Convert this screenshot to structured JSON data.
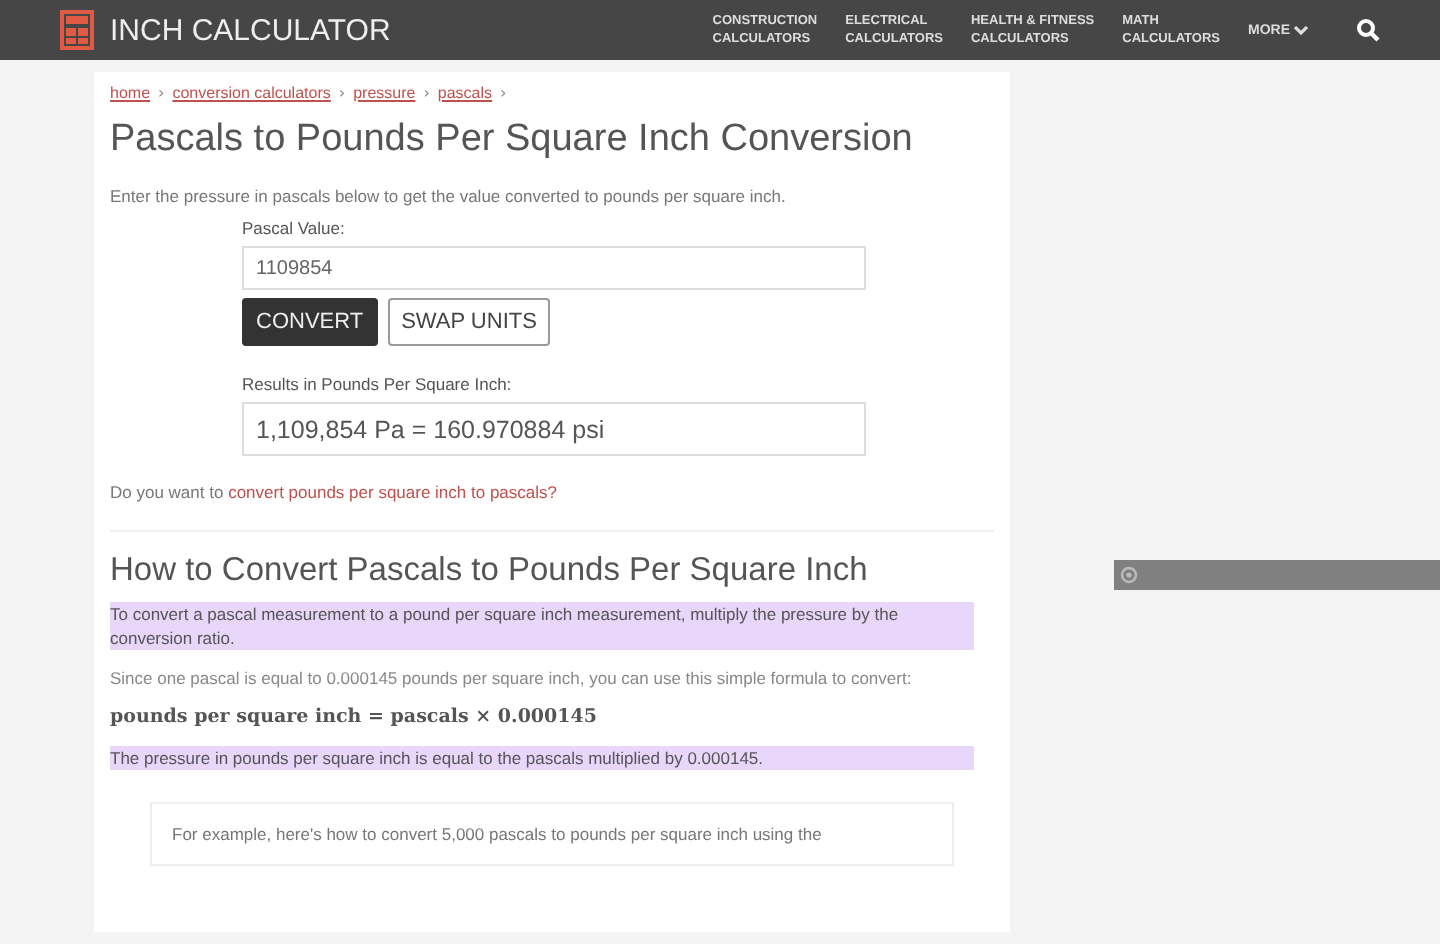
{
  "header": {
    "logo": "INCH CALCULATOR",
    "nav": [
      {
        "line1": "CONSTRUCTION",
        "line2": "CALCULATORS"
      },
      {
        "line1": "ELECTRICAL",
        "line2": "CALCULATORS"
      },
      {
        "line1": "HEALTH & FITNESS",
        "line2": "CALCULATORS"
      },
      {
        "line1": "MATH",
        "line2": "CALCULATORS"
      }
    ],
    "more": "MORE"
  },
  "breadcrumbs": [
    "home",
    "conversion calculators",
    "pressure",
    "pascals"
  ],
  "breadcrumb_separator": "›",
  "title": "Pascals to Pounds Per Square Inch Conversion",
  "intro": "Enter the pressure in pascals below to get the value converted to pounds per square inch.",
  "input": {
    "label": "Pascal Value:",
    "value": "1109854"
  },
  "buttons": [
    {
      "label": "CONVERT",
      "kind": "primary"
    },
    {
      "label": "SWAP UNITS",
      "kind": "secondary"
    }
  ],
  "result": {
    "label": "Results in Pounds Per Square Inch:",
    "value": "1,109,854 Pa = 160.970884 psi"
  },
  "reverse": {
    "prefix": "Do you want to ",
    "link": "convert pounds per square inch to pascals?"
  },
  "section_title": "How to Convert Pascals to Pounds Per Square Inch",
  "paragraphs": [
    {
      "kind": "highlight",
      "text": "To convert a pascal measurement to a pound per square inch measurement, multiply the pressure by the conversion ratio."
    },
    {
      "kind": "plain",
      "text": "Since one pascal is equal to 0.000145 pounds per square inch, you can use this simple formula to convert:"
    },
    {
      "kind": "formula",
      "text": "pounds per square inch = pascals × 0.000145"
    },
    {
      "kind": "highlight",
      "text": "The pressure in pounds per square inch is equal to the pascals multiplied by 0.000145."
    }
  ],
  "example": "For example, here's how to convert 5,000 pascals to pounds per square inch using the"
}
